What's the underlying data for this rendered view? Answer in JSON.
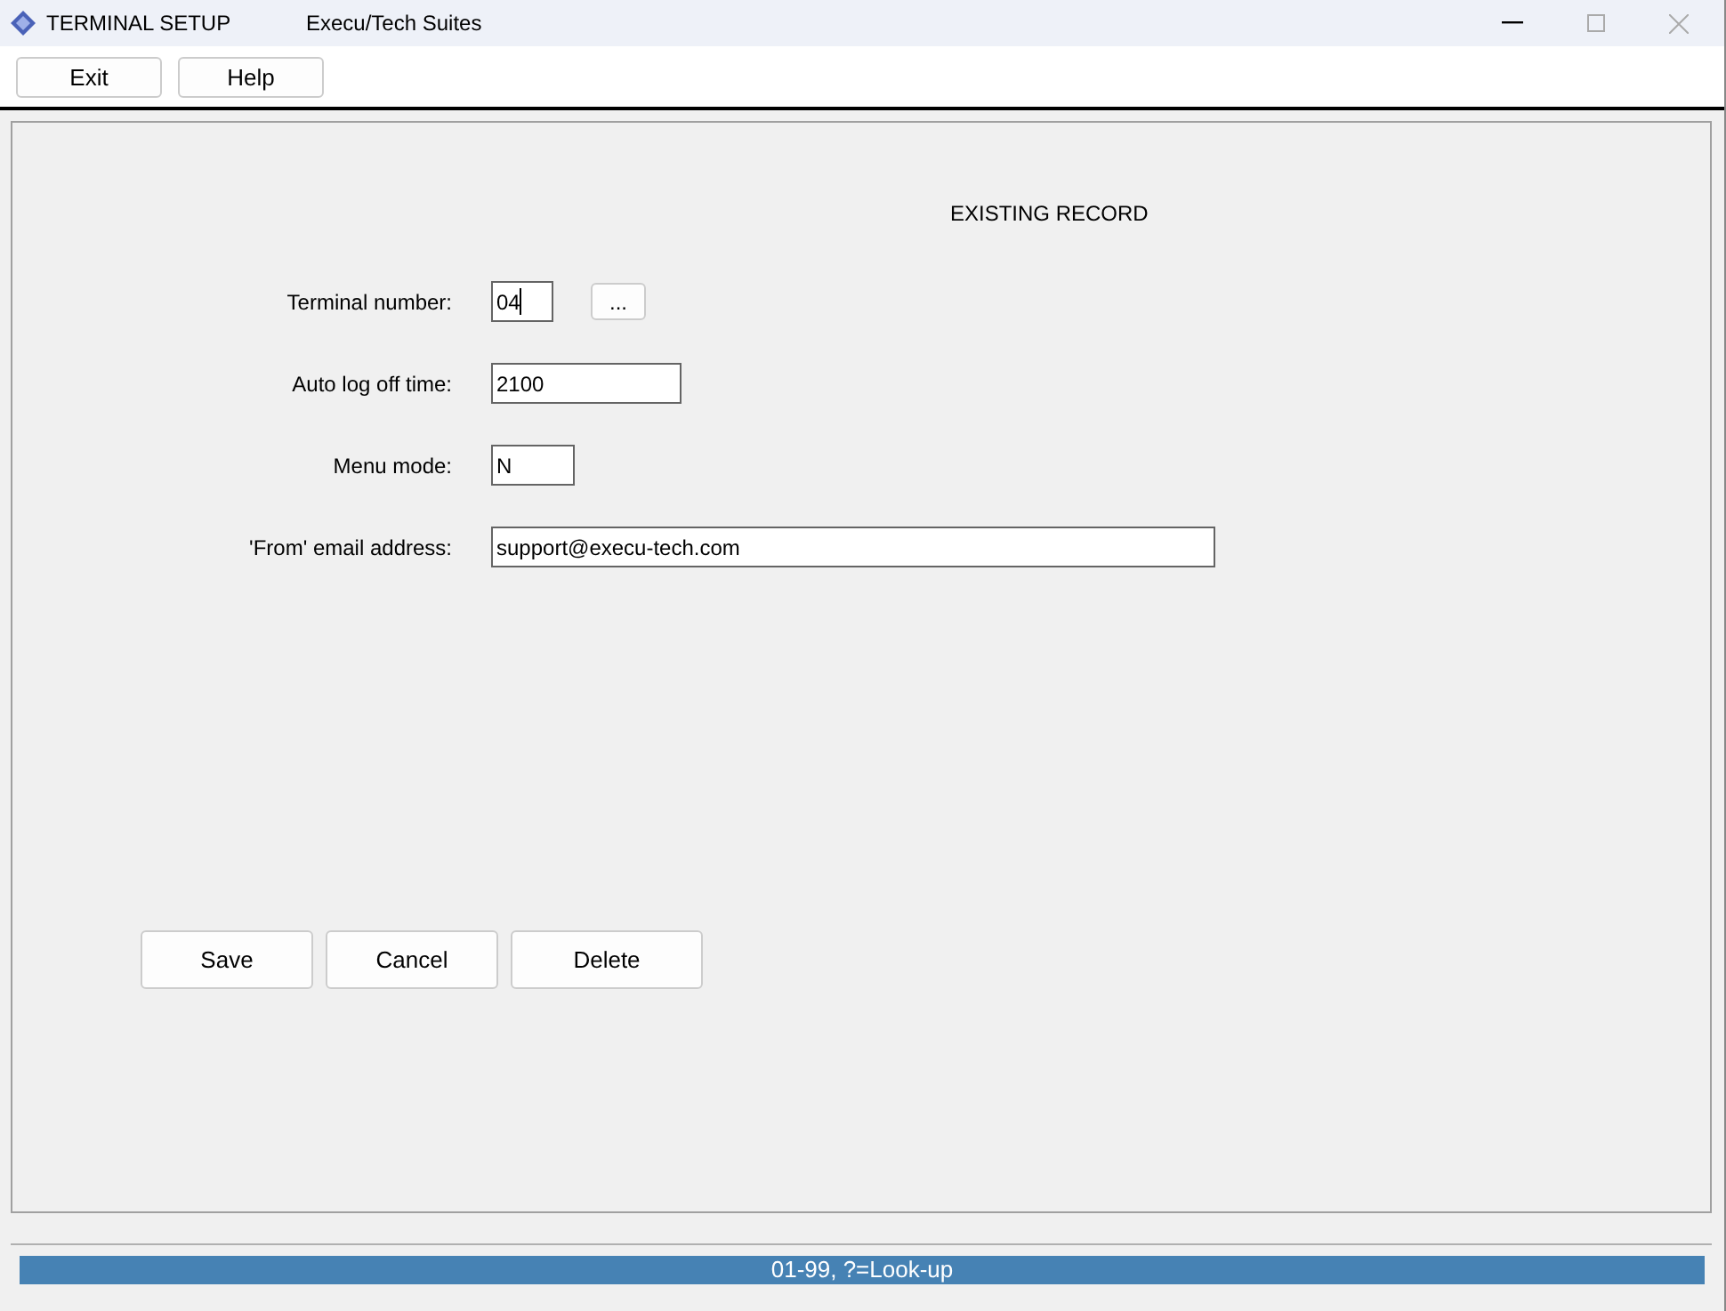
{
  "window": {
    "title": "TERMINAL SETUP",
    "subtitle": "Execu/Tech Suites"
  },
  "toolbar": [
    "Exit",
    "Help"
  ],
  "heading": "EXISTING RECORD",
  "fields": [
    {
      "label": "Terminal number:",
      "value": "04",
      "focused": true,
      "lookup": "..."
    },
    {
      "label": "Auto log off time:",
      "value": "2100",
      "focused": false
    },
    {
      "label": "Menu mode:",
      "value": "N",
      "focused": false
    },
    {
      "label": "'From' email address:",
      "value": "support@execu-tech.com",
      "focused": false
    }
  ],
  "buttons": [
    "Save",
    "Cancel",
    "Delete"
  ],
  "status_bar": "01-99, ?=Look-up"
}
